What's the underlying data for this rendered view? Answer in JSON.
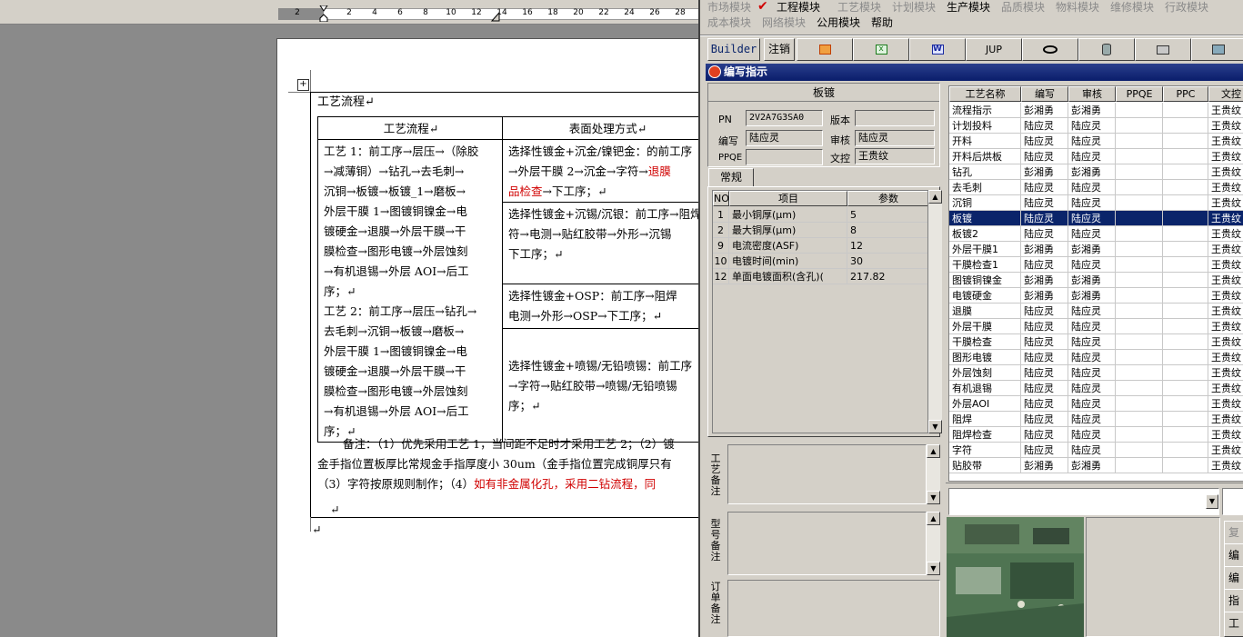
{
  "ruler": {
    "ticks": [
      "2",
      "2",
      "4",
      "6",
      "8",
      "10",
      "12",
      "14",
      "16",
      "18",
      "20",
      "22",
      "24",
      "26",
      "28"
    ]
  },
  "doc": {
    "title": "工艺流程↵",
    "col1_header": "工艺流程↵",
    "col2_header": "表面处理方式↵",
    "col1_lines": [
      "工艺 1：前工序→层压→（除胶",
      "→减薄铜）→钻孔→去毛刺→",
      "沉铜→板镀→板镀_1→磨板→",
      "外层干膜 1→图镀铜镍金→电",
      "镀硬金→退膜→外层干膜→干",
      "膜检查→图形电镀→外层蚀刻",
      "→有机退锡→外层 AOI→后工",
      "序；↵",
      "工艺 2：前工序→层压→钻孔→",
      "去毛刺→沉铜→板镀→磨板→",
      "外层干膜 1→图镀铜镍金→电",
      "镀硬金→退膜→外层干膜→干",
      "膜检查→图形电镀→外层蚀刻",
      "→有机退锡→外层 AOI→后工",
      "序；↵"
    ],
    "c2a_l1": "选择性镀金+沉金/镍钯金：的前工序",
    "c2a_l2a": "→外层干膜 2→沉金→字符→",
    "c2a_l2b": "退膜",
    "c2a_l3a": "品检查",
    "c2a_l3b": "→下工序；↵",
    "c2b_lines": [
      "选择性镀金+沉锡/沉银：前工序→阻焊",
      "符→电测→贴红胶带→外形→沉锡",
      "下工序；↵"
    ],
    "c2c_lines": [
      "选择性镀金+OSP：前工序→阻焊",
      "电测→外形→OSP→下工序；↵"
    ],
    "c2d_lines": [
      "选择性镀金+喷锡/无铅喷锡：前工序",
      "→字符→贴红胶带→喷锡/无铅喷锡",
      "序；↵"
    ],
    "note1": "备注：（1）优先采用工艺 1，当间距不足时才采用工艺 2；（2）镀",
    "note2": "金手指位置板厚比常规金手指厚度小 30um（金手指位置完成铜厚只有",
    "note3a": "（3）字符按原规则制作；（4）",
    "note3b": "如有非金属化孔，采用二钻流程，同",
    "end_mark": "↵",
    "after_mark": "↵"
  },
  "menu": {
    "row1": [
      "市场模块",
      "工程模块",
      "工艺模块",
      "计划模块",
      "生产模块",
      "品质模块",
      "物料模块",
      "维修模块",
      "行政模块"
    ],
    "row2": [
      "成本模块",
      "网络模块",
      "公用模块",
      "帮助"
    ],
    "check": "✔"
  },
  "toolbar": {
    "builder": "Builder",
    "logout": "注销",
    "jup": "JUP"
  },
  "panel": {
    "title": "编写指示"
  },
  "form": {
    "group_title": "板镀",
    "pn_label": "PN",
    "pn_value": "2V2A7G3SA0",
    "version_label": "版本",
    "version_value": "",
    "writer_label": "编写",
    "writer_value": "陆应灵",
    "reviewer_label": "审核",
    "reviewer_value": "陆应灵",
    "ppqe_label": "PPQE",
    "ppqe_value": "",
    "doc_ctrl_label": "文控",
    "doc_ctrl_value": "王贵纹",
    "tab": "常规"
  },
  "params": {
    "headers": [
      "NO",
      "项目",
      "参数"
    ],
    "rows": [
      {
        "no": "1",
        "item": "最小铜厚(μm)",
        "val": "5"
      },
      {
        "no": "2",
        "item": "最大铜厚(μm)",
        "val": "8"
      },
      {
        "no": "9",
        "item": "电流密度(ASF)",
        "val": "12"
      },
      {
        "no": "10",
        "item": "电镀时间(min)",
        "val": "30"
      },
      {
        "no": "12",
        "item": "单面电镀面积(含孔)(",
        "val": "217.82"
      }
    ]
  },
  "remarks": {
    "process": "工艺备注",
    "model": "型号备注",
    "order": "订单备注"
  },
  "process_list": {
    "headers": [
      "工艺名称",
      "编写",
      "审核",
      "PPQE",
      "PPC",
      "文控"
    ],
    "selected_index": 7,
    "rows": [
      [
        "流程指示",
        "彭湘勇",
        "彭湘勇",
        "",
        "",
        "王贵纹"
      ],
      [
        "计划投料",
        "陆应灵",
        "陆应灵",
        "",
        "",
        "王贵纹"
      ],
      [
        "开料",
        "陆应灵",
        "陆应灵",
        "",
        "",
        "王贵纹"
      ],
      [
        "开料后烘板",
        "陆应灵",
        "陆应灵",
        "",
        "",
        "王贵纹"
      ],
      [
        "钻孔",
        "彭湘勇",
        "彭湘勇",
        "",
        "",
        "王贵纹"
      ],
      [
        "去毛刺",
        "陆应灵",
        "陆应灵",
        "",
        "",
        "王贵纹"
      ],
      [
        "沉铜",
        "陆应灵",
        "陆应灵",
        "",
        "",
        "王贵纹"
      ],
      [
        "板镀",
        "陆应灵",
        "陆应灵",
        "",
        "",
        "王贵纹"
      ],
      [
        "板镀2",
        "陆应灵",
        "陆应灵",
        "",
        "",
        "王贵纹"
      ],
      [
        "外层干膜1",
        "彭湘勇",
        "彭湘勇",
        "",
        "",
        "王贵纹"
      ],
      [
        "干膜检查1",
        "陆应灵",
        "陆应灵",
        "",
        "",
        "王贵纹"
      ],
      [
        "图镀铜镍金",
        "彭湘勇",
        "彭湘勇",
        "",
        "",
        "王贵纹"
      ],
      [
        "电镀硬金",
        "彭湘勇",
        "彭湘勇",
        "",
        "",
        "王贵纹"
      ],
      [
        "退膜",
        "陆应灵",
        "陆应灵",
        "",
        "",
        "王贵纹"
      ],
      [
        "外层干膜",
        "陆应灵",
        "陆应灵",
        "",
        "",
        "王贵纹"
      ],
      [
        "干膜检查",
        "陆应灵",
        "陆应灵",
        "",
        "",
        "王贵纹"
      ],
      [
        "图形电镀",
        "陆应灵",
        "陆应灵",
        "",
        "",
        "王贵纹"
      ],
      [
        "外层蚀刻",
        "陆应灵",
        "陆应灵",
        "",
        "",
        "王贵纹"
      ],
      [
        "有机退锡",
        "陆应灵",
        "陆应灵",
        "",
        "",
        "王贵纹"
      ],
      [
        "外层AOI",
        "陆应灵",
        "陆应灵",
        "",
        "",
        "王贵纹"
      ],
      [
        "阻焊",
        "陆应灵",
        "陆应灵",
        "",
        "",
        "王贵纹"
      ],
      [
        "阻焊检查",
        "陆应灵",
        "陆应灵",
        "",
        "",
        "王贵纹"
      ],
      [
        "字符",
        "陆应灵",
        "陆应灵",
        "",
        "",
        "王贵纹"
      ],
      [
        "贴胶带",
        "彭湘勇",
        "彭湘勇",
        "",
        "",
        "王贵纹"
      ]
    ]
  },
  "right_buttons": [
    "复",
    "编",
    "编",
    "指",
    "工"
  ],
  "colors": {
    "selection": "#0a246a",
    "title_bar": "#0a1d6b",
    "window_bg": "#d4d0c8",
    "doc_red": "#d00000"
  }
}
